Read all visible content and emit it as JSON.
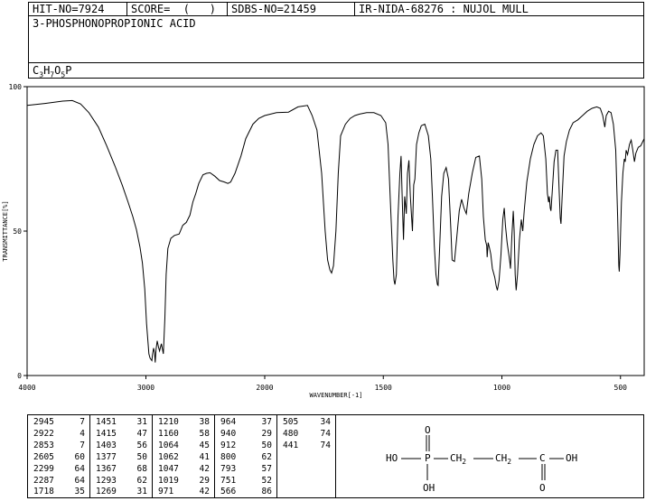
{
  "header": {
    "hit_no": "HIT-NO=7924",
    "score": "SCORE=  (   )",
    "sdbs_no": "SDBS-NO=21459",
    "ir": "IR-NIDA-68276 : NUJOL MULL"
  },
  "compound_name": "3-PHOSPHONOPROPIONIC ACID",
  "formula": {
    "p1": "C",
    "s1": "3",
    "p2": "H",
    "s2": "7",
    "p3": "O",
    "s3": "5",
    "p4": "P"
  },
  "structure": {
    "ho_left": "HO",
    "p": "P",
    "o_top": "O",
    "oh_bottom": "OH",
    "ch2a": "CH",
    "ch2a_sub": "2",
    "ch2b": "CH",
    "ch2b_sub": "2",
    "c": "C",
    "oh_right": "OH",
    "o_bottom": "O"
  },
  "peaks": [
    [
      [
        "2945",
        "7"
      ],
      [
        "2922",
        "4"
      ],
      [
        "2853",
        "7"
      ],
      [
        "2605",
        "60"
      ],
      [
        "2299",
        "64"
      ],
      [
        "2287",
        "64"
      ],
      [
        "1718",
        "35"
      ]
    ],
    [
      [
        "1451",
        "31"
      ],
      [
        "1415",
        "47"
      ],
      [
        "1403",
        "56"
      ],
      [
        "1377",
        "50"
      ],
      [
        "1367",
        "68"
      ],
      [
        "1293",
        "62"
      ],
      [
        "1269",
        "31"
      ]
    ],
    [
      [
        "1210",
        "38"
      ],
      [
        "1160",
        "58"
      ],
      [
        "1064",
        "45"
      ],
      [
        "1062",
        "41"
      ],
      [
        "1047",
        "42"
      ],
      [
        "1019",
        "29"
      ],
      [
        "971",
        "42"
      ]
    ],
    [
      [
        "964",
        "37"
      ],
      [
        "940",
        "29"
      ],
      [
        "912",
        "50"
      ],
      [
        "800",
        "62"
      ],
      [
        "793",
        "57"
      ],
      [
        "751",
        "52"
      ],
      [
        "566",
        "86"
      ]
    ],
    [
      [
        "505",
        "34"
      ],
      [
        "480",
        "74"
      ],
      [
        "441",
        "74"
      ]
    ]
  ],
  "chart_data": {
    "type": "line",
    "xlabel": "WAVENUMBER[-1]",
    "ylabel": "TRANSMITTANCE[%]",
    "xlim": [
      4000,
      400
    ],
    "ylim": [
      0,
      100
    ],
    "xticks": [
      "4000",
      "3000",
      "2000",
      "1500",
      "1000",
      "500"
    ],
    "yticks": [
      "100",
      "50",
      "0"
    ],
    "series": [
      {
        "points": [
          [
            4000,
            93.5
          ],
          [
            3850,
            94.2
          ],
          [
            3700,
            95.0
          ],
          [
            3620,
            95.2
          ],
          [
            3550,
            94.0
          ],
          [
            3480,
            91.0
          ],
          [
            3400,
            86.0
          ],
          [
            3330,
            79.5
          ],
          [
            3260,
            72.5
          ],
          [
            3200,
            66.0
          ],
          [
            3150,
            60.0
          ],
          [
            3110,
            55.0
          ],
          [
            3080,
            50.5
          ],
          [
            3050,
            44.5
          ],
          [
            3030,
            39.0
          ],
          [
            3010,
            30.0
          ],
          [
            2995,
            18.0
          ],
          [
            2975,
            7.5
          ],
          [
            2965,
            6.0
          ],
          [
            2950,
            5.2
          ],
          [
            2945,
            7.0
          ],
          [
            2935,
            9.5
          ],
          [
            2928,
            8.0
          ],
          [
            2922,
            4.5
          ],
          [
            2915,
            9.0
          ],
          [
            2905,
            12.0
          ],
          [
            2895,
            10.0
          ],
          [
            2885,
            8.5
          ],
          [
            2870,
            11.0
          ],
          [
            2860,
            9.0
          ],
          [
            2853,
            7.5
          ],
          [
            2840,
            20.0
          ],
          [
            2830,
            35.0
          ],
          [
            2815,
            44.0
          ],
          [
            2790,
            47.5
          ],
          [
            2760,
            48.5
          ],
          [
            2720,
            49.0
          ],
          [
            2690,
            52.0
          ],
          [
            2660,
            53.0
          ],
          [
            2630,
            55.5
          ],
          [
            2605,
            60.0
          ],
          [
            2580,
            63.0
          ],
          [
            2555,
            66.5
          ],
          [
            2520,
            69.5
          ],
          [
            2490,
            70.0
          ],
          [
            2460,
            70.2
          ],
          [
            2420,
            69.0
          ],
          [
            2380,
            67.5
          ],
          [
            2340,
            67.0
          ],
          [
            2310,
            66.5
          ],
          [
            2287,
            67.0
          ],
          [
            2250,
            70.0
          ],
          [
            2200,
            76.0
          ],
          [
            2160,
            82.0
          ],
          [
            2100,
            87.0
          ],
          [
            2050,
            89.0
          ],
          [
            2000,
            90.0
          ],
          [
            1950,
            91.0
          ],
          [
            1900,
            91.2
          ],
          [
            1860,
            93.0
          ],
          [
            1820,
            93.5
          ],
          [
            1800,
            90.0
          ],
          [
            1780,
            85.0
          ],
          [
            1760,
            70.0
          ],
          [
            1745,
            50.0
          ],
          [
            1735,
            40.0
          ],
          [
            1725,
            36.5
          ],
          [
            1718,
            35.5
          ],
          [
            1710,
            38.0
          ],
          [
            1700,
            50.0
          ],
          [
            1690,
            70.0
          ],
          [
            1680,
            83.0
          ],
          [
            1660,
            87.0
          ],
          [
            1640,
            89.0
          ],
          [
            1620,
            90.0
          ],
          [
            1600,
            90.5
          ],
          [
            1570,
            91.0
          ],
          [
            1540,
            91.0
          ],
          [
            1510,
            90.0
          ],
          [
            1490,
            87.5
          ],
          [
            1480,
            80.0
          ],
          [
            1470,
            60.0
          ],
          [
            1460,
            40.0
          ],
          [
            1455,
            33.0
          ],
          [
            1451,
            31.5
          ],
          [
            1445,
            35.0
          ],
          [
            1438,
            55.0
          ],
          [
            1430,
            70.0
          ],
          [
            1425,
            76.0
          ],
          [
            1420,
            60.0
          ],
          [
            1415,
            47.0
          ],
          [
            1410,
            62.0
          ],
          [
            1403,
            56.0
          ],
          [
            1398,
            70.0
          ],
          [
            1392,
            74.5
          ],
          [
            1386,
            62.0
          ],
          [
            1377,
            50.0
          ],
          [
            1372,
            66.0
          ],
          [
            1367,
            68.0
          ],
          [
            1360,
            80.0
          ],
          [
            1350,
            84.0
          ],
          [
            1340,
            86.5
          ],
          [
            1325,
            87.0
          ],
          [
            1310,
            83.0
          ],
          [
            1300,
            75.0
          ],
          [
            1293,
            62.0
          ],
          [
            1285,
            45.0
          ],
          [
            1278,
            35.0
          ],
          [
            1272,
            31.5
          ],
          [
            1269,
            31.2
          ],
          [
            1262,
            45.0
          ],
          [
            1254,
            62.0
          ],
          [
            1245,
            70.0
          ],
          [
            1235,
            72.0
          ],
          [
            1225,
            68.0
          ],
          [
            1215,
            50.0
          ],
          [
            1210,
            40.0
          ],
          [
            1200,
            39.5
          ],
          [
            1190,
            48.0
          ],
          [
            1180,
            57.0
          ],
          [
            1170,
            61.0
          ],
          [
            1160,
            58.0
          ],
          [
            1150,
            56.0
          ],
          [
            1140,
            63.0
          ],
          [
            1125,
            70.0
          ],
          [
            1110,
            75.5
          ],
          [
            1095,
            76.0
          ],
          [
            1085,
            68.0
          ],
          [
            1078,
            55.0
          ],
          [
            1070,
            47.0
          ],
          [
            1064,
            45.0
          ],
          [
            1062,
            41.0
          ],
          [
            1058,
            46.0
          ],
          [
            1052,
            44.0
          ],
          [
            1047,
            42.0
          ],
          [
            1040,
            37.0
          ],
          [
            1030,
            34.0
          ],
          [
            1024,
            31.0
          ],
          [
            1019,
            29.5
          ],
          [
            1012,
            33.0
          ],
          [
            1004,
            42.0
          ],
          [
            996,
            54.0
          ],
          [
            990,
            58.0
          ],
          [
            985,
            52.0
          ],
          [
            978,
            46.0
          ],
          [
            971,
            42.0
          ],
          [
            966,
            39.0
          ],
          [
            964,
            37.0
          ],
          [
            958,
            48.0
          ],
          [
            952,
            57.0
          ],
          [
            948,
            50.0
          ],
          [
            944,
            35.0
          ],
          [
            940,
            29.5
          ],
          [
            934,
            35.0
          ],
          [
            926,
            47.0
          ],
          [
            918,
            54.0
          ],
          [
            912,
            50.0
          ],
          [
            906,
            57.0
          ],
          [
            895,
            67.0
          ],
          [
            880,
            75.0
          ],
          [
            865,
            80.0
          ],
          [
            850,
            83.0
          ],
          [
            835,
            84.0
          ],
          [
            825,
            83.0
          ],
          [
            815,
            75.0
          ],
          [
            808,
            63.0
          ],
          [
            803,
            60.0
          ],
          [
            800,
            62.0
          ],
          [
            796,
            58.0
          ],
          [
            793,
            57.0
          ],
          [
            788,
            63.0
          ],
          [
            780,
            74.0
          ],
          [
            772,
            78.0
          ],
          [
            765,
            78.0
          ],
          [
            758,
            63.0
          ],
          [
            754,
            54.5
          ],
          [
            751,
            52.5
          ],
          [
            746,
            62.0
          ],
          [
            738,
            76.0
          ],
          [
            728,
            81.0
          ],
          [
            715,
            85.0
          ],
          [
            700,
            87.5
          ],
          [
            680,
            88.5
          ],
          [
            660,
            90.0
          ],
          [
            640,
            91.5
          ],
          [
            620,
            92.5
          ],
          [
            600,
            93.0
          ],
          [
            585,
            92.5
          ],
          [
            575,
            90.0
          ],
          [
            566,
            86.0
          ],
          [
            560,
            90.0
          ],
          [
            550,
            91.5
          ],
          [
            540,
            91.0
          ],
          [
            530,
            87.0
          ],
          [
            520,
            78.0
          ],
          [
            512,
            55.0
          ],
          [
            507,
            38.0
          ],
          [
            505,
            36.0
          ],
          [
            502,
            42.0
          ],
          [
            496,
            60.0
          ],
          [
            490,
            70.0
          ],
          [
            484,
            75.0
          ],
          [
            480,
            74.0
          ],
          [
            476,
            78.0
          ],
          [
            470,
            76.5
          ],
          [
            462,
            80.0
          ],
          [
            455,
            81.5
          ],
          [
            448,
            78.0
          ],
          [
            441,
            74.0
          ],
          [
            435,
            77.0
          ],
          [
            425,
            79.0
          ],
          [
            415,
            79.5
          ],
          [
            400,
            82.0
          ]
        ]
      }
    ]
  }
}
